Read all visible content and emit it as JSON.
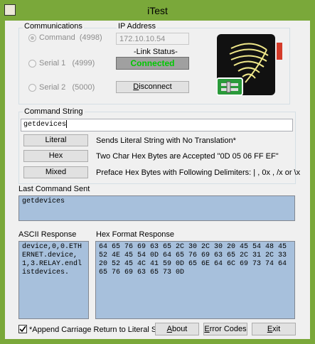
{
  "window": {
    "title": "iTest"
  },
  "communications": {
    "label": "Communications",
    "options": [
      {
        "label": "Command",
        "port": "(4998)",
        "selected": true
      },
      {
        "label": "Serial 1",
        "port": "(4999)",
        "selected": false
      },
      {
        "label": "Serial 2",
        "port": "(5000)",
        "selected": false
      }
    ]
  },
  "ip": {
    "label": "IP Address",
    "value": "172.10.10.54",
    "link_status_label": "-Link Status-",
    "link_status_value": "Connected",
    "disconnect_prefix": "",
    "disconnect_hot": "D",
    "disconnect_rest": "isconnect",
    "status_color": "#00c800"
  },
  "command_string": {
    "label": "Command String",
    "value": "getdevices"
  },
  "modes": [
    {
      "button": "Literal",
      "description": "Sends Literal String with No Translation*"
    },
    {
      "button": "Hex",
      "description": "Two Char Hex Bytes are Accepted \"0D 05 06 FF EF\""
    },
    {
      "button": "Mixed",
      "description": "Preface Hex Bytes with Following Delimiters: | , 0x , /x or \\x"
    }
  ],
  "last_command": {
    "label": "Last Command Sent",
    "value": "getdevices"
  },
  "ascii_response": {
    "label": "ASCII Response",
    "value": "device,0,0.ETHERNET.device,1,3.RELAY.endlistdevices."
  },
  "hex_response": {
    "label": "Hex Format Response",
    "value": "64 65 76 69 63 65 2C 30 2C 30 20 45 54 48 45 52 4E 45 54 0D 64 65 76 69 63 65 2C 31 2C 33 20 52 45 4C 41 59 0D 65 6E 64 6C 69 73 74 64 65 76 69 63 65 73 0D"
  },
  "footer": {
    "append_cr_label": "*Append Carriage Return to Literal Send",
    "append_cr_checked": true,
    "about": {
      "hot": "A",
      "rest": "bout"
    },
    "error_codes": {
      "hot": "E",
      "rest": "rror Codes"
    },
    "exit": {
      "hot": "E",
      "rest": "xit",
      "prefix": ""
    }
  },
  "colors": {
    "titlebar": "#7aa83a",
    "response_bg": "#a7c0dc"
  }
}
